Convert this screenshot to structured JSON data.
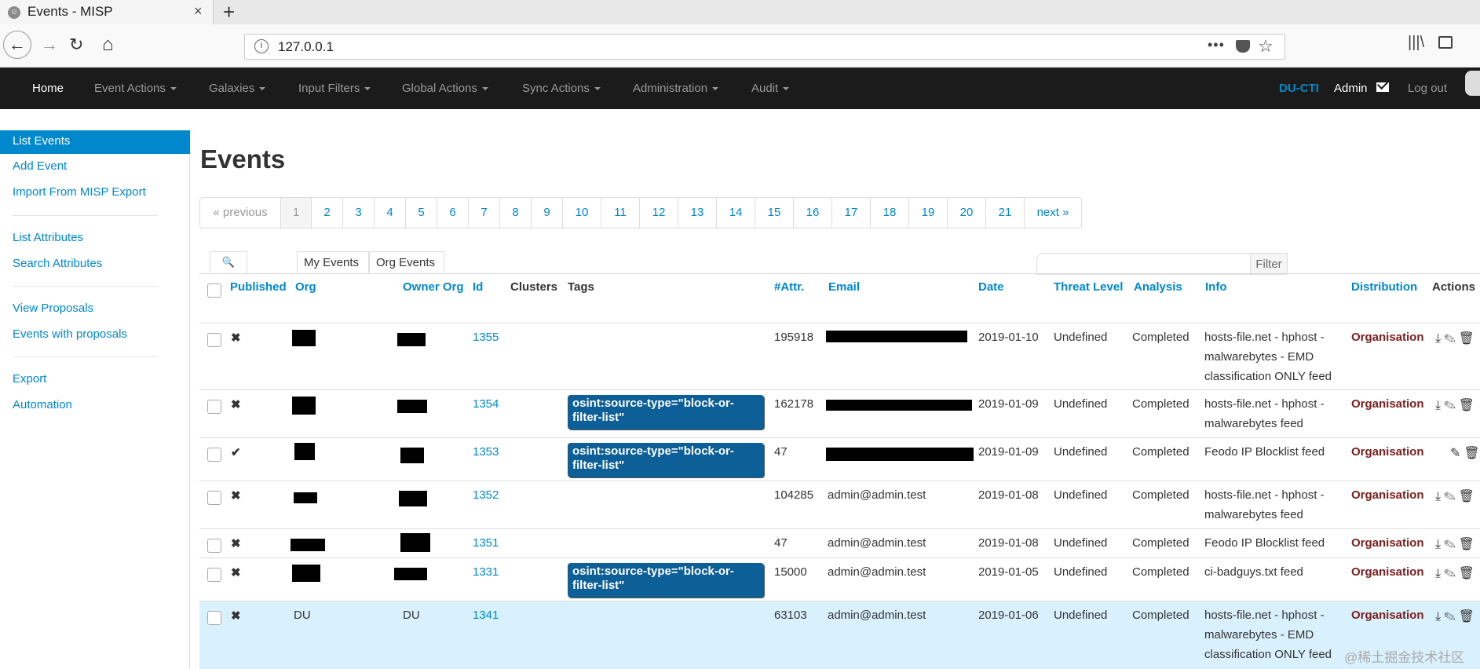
{
  "browser": {
    "tab_title": "Events - MISP",
    "favicon": "misp-favicon",
    "close": "×",
    "new_tab": "+",
    "url": "127.0.0.1",
    "url_info": "i",
    "url_dots": "•••",
    "star": "☆",
    "library": "|||\\",
    "back": "←",
    "forward": "→",
    "reload": "↻",
    "home": "⌂"
  },
  "appnav": {
    "home": "Home",
    "event_actions": "Event Actions",
    "galaxies": "Galaxies",
    "input_filters": "Input Filters",
    "global_actions": "Global Actions",
    "sync_actions": "Sync Actions",
    "administration": "Administration",
    "audit": "Audit",
    "org": "DU-CTI",
    "user": "Admin",
    "logout": "Log out"
  },
  "sidebar": {
    "list_events": "List Events",
    "add_event": "Add Event",
    "import_misp": "Import From MISP Export",
    "list_attributes": "List Attributes",
    "search_attributes": "Search Attributes",
    "view_proposals": "View Proposals",
    "events_with_proposals": "Events with proposals",
    "export": "Export",
    "automation": "Automation"
  },
  "main": {
    "title": "Events",
    "pagination": [
      "« previous",
      "1",
      "2",
      "3",
      "4",
      "5",
      "6",
      "7",
      "8",
      "9",
      "10",
      "11",
      "12",
      "13",
      "14",
      "15",
      "16",
      "17",
      "18",
      "19",
      "20",
      "21",
      "next »"
    ],
    "my_events": "My Events",
    "org_events": "Org Events",
    "filter": "Filter",
    "search_icon_glyph": "🔍"
  },
  "table": {
    "headers": {
      "published": "Published",
      "org": "Org",
      "owner_org": "Owner Org",
      "id": "Id",
      "clusters": "Clusters",
      "tags": "Tags",
      "attr": "#Attr.",
      "email": "Email",
      "date": "Date",
      "threat": "Threat Level",
      "analysis": "Analysis",
      "info": "Info",
      "distribution": "Distribution",
      "actions": "Actions"
    },
    "rows": [
      {
        "published": "✖",
        "org": "",
        "owner": "",
        "id": "1355",
        "tag": "",
        "attr": "195918",
        "email": "",
        "date": "2019-01-10",
        "threat": "Undefined",
        "analysis": "Completed",
        "info": "hosts-file.net - hphost - malwarebytes - EMD classification ONLY feed",
        "dist": "Organisation",
        "actions": "⤓✎🗑"
      },
      {
        "published": "✖",
        "org": "",
        "owner": "",
        "id": "1354",
        "tag": "osint:source-type=\"block-or-filter-list\"",
        "attr": "162178",
        "email": "",
        "date": "2019-01-09",
        "threat": "Undefined",
        "analysis": "Completed",
        "info": "hosts-file.net - hphost - malwarebytes feed",
        "dist": "Organisation",
        "actions": "⤓✎🗑"
      },
      {
        "published": "✔",
        "org": "",
        "owner": "",
        "id": "1353",
        "tag": "osint:source-type=\"block-or-filter-list\"",
        "attr": "47",
        "email": "",
        "date": "2019-01-09",
        "threat": "Undefined",
        "analysis": "Completed",
        "info": "Feodo IP Blocklist feed",
        "dist": "Organisation",
        "actions": "✎🗑"
      },
      {
        "published": "✖",
        "org": "",
        "owner": "",
        "id": "1352",
        "tag": "",
        "attr": "104285",
        "email": "admin@admin.test",
        "date": "2019-01-08",
        "threat": "Undefined",
        "analysis": "Completed",
        "info": "hosts-file.net - hphost - malwarebytes feed",
        "dist": "Organisation",
        "actions": "⤓✎🗑"
      },
      {
        "published": "✖",
        "org": "",
        "owner": "",
        "id": "1351",
        "tag": "",
        "attr": "47",
        "email": "admin@admin.test",
        "date": "2019-01-08",
        "threat": "Undefined",
        "analysis": "Completed",
        "info": "Feodo IP Blocklist feed",
        "dist": "Organisation",
        "actions": "⤓✎🗑"
      },
      {
        "published": "✖",
        "org": "",
        "owner": "",
        "id": "1331",
        "tag": "osint:source-type=\"block-or-filter-list\"",
        "attr": "15000",
        "email": "admin@admin.test",
        "date": "2019-01-05",
        "threat": "Undefined",
        "analysis": "Completed",
        "info": "ci-badguys.txt feed",
        "dist": "Organisation",
        "actions": "⤓✎🗑"
      },
      {
        "published": "✖",
        "org": "DU",
        "owner": "DU",
        "id": "1341",
        "tag": "",
        "attr": "63103",
        "email": "admin@admin.test",
        "date": "2019-01-06",
        "threat": "Undefined",
        "analysis": "Completed",
        "info": "hosts-file.net - hphost - malwarebytes - EMD classification ONLY feed",
        "dist": "Organisation",
        "actions": "⤓✎🗑"
      }
    ]
  },
  "watermark": "@稀土掘金技术社区",
  "colors": {
    "accent": "#0088cc",
    "navbar": "#1b1b1b",
    "highlight_row": "#d9f1fd",
    "tag": "#0d5f97",
    "distribution": "#7a1d1d"
  }
}
